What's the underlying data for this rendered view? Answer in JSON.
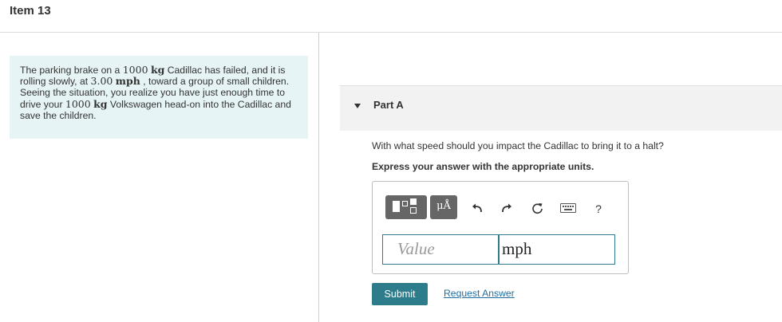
{
  "header": {
    "title": "Item 13"
  },
  "problem": {
    "segments": [
      "The parking brake on a ",
      "1000",
      "kg",
      " Cadillac has failed, and it is rolling slowly, at ",
      "3.00",
      "mph",
      " , toward a group of small children. Seeing the situation, you realize you have just enough time to drive your ",
      "1000",
      "kg",
      " Volkswagen head-on into the Cadillac and save the children."
    ]
  },
  "part": {
    "label": "Part A"
  },
  "question": {
    "text": "With what speed should you impact the Cadillac to bring it to a halt?",
    "instruction": "Express your answer with the appropriate units."
  },
  "toolbar": {
    "units_glyph": "μÅ",
    "help_label": "?",
    "icons": [
      "templates-icon",
      "units-icon",
      "undo-icon",
      "redo-icon",
      "reset-icon",
      "keyboard-icon",
      "help-icon"
    ]
  },
  "answer": {
    "value_placeholder": "Value",
    "unit_value": "mph"
  },
  "actions": {
    "submit_label": "Submit",
    "request_label": "Request Answer"
  },
  "colors": {
    "accent": "#2c7c8c",
    "link": "#1f6fa3",
    "problem_bg": "#e7f4f6",
    "part_bar_bg": "#f2f2f2"
  }
}
